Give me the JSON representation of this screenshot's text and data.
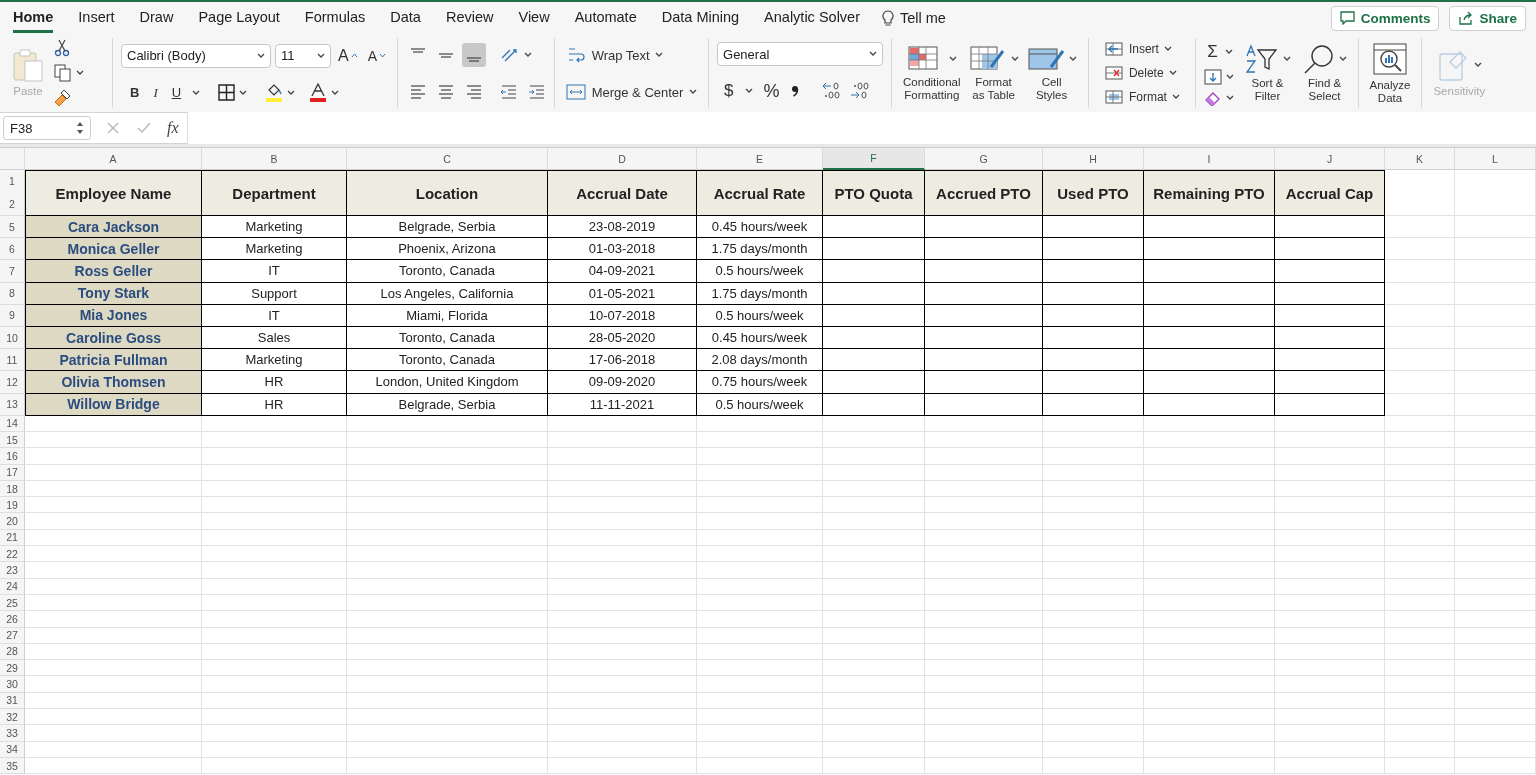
{
  "tabs": [
    {
      "label": "Home",
      "selected": true
    },
    {
      "label": "Insert",
      "selected": false
    },
    {
      "label": "Draw",
      "selected": false
    },
    {
      "label": "Page Layout",
      "selected": false
    },
    {
      "label": "Formulas",
      "selected": false
    },
    {
      "label": "Data",
      "selected": false
    },
    {
      "label": "Review",
      "selected": false
    },
    {
      "label": "View",
      "selected": false
    },
    {
      "label": "Automate",
      "selected": false
    },
    {
      "label": "Data Mining",
      "selected": false
    },
    {
      "label": "Analytic Solver",
      "selected": false
    }
  ],
  "tell_me": "Tell me",
  "top_buttons": {
    "comments": "Comments",
    "share": "Share"
  },
  "ribbon": {
    "paste": {
      "label": "Paste",
      "disabled": true
    },
    "font": {
      "name": "Calibri (Body)",
      "size": "11",
      "grow": "A",
      "shrink": "A",
      "bold": "B",
      "italic": "I",
      "underline": "U"
    },
    "vertical_align": [
      {
        "kind": "top",
        "selected": false
      },
      {
        "kind": "middle",
        "selected": false
      },
      {
        "kind": "bottom",
        "selected": true
      }
    ],
    "horizontal_align": [
      {
        "kind": "left",
        "selected": false
      },
      {
        "kind": "center",
        "selected": false
      },
      {
        "kind": "right",
        "selected": false
      }
    ],
    "wrap_text": "Wrap Text",
    "merge": "Merge & Center",
    "number": {
      "format": "General",
      "currency": "$",
      "percent": "%"
    },
    "styles": [
      {
        "kind": "conditional",
        "lines": [
          "Conditional",
          "Formatting"
        ]
      },
      {
        "kind": "table",
        "lines": [
          "Format",
          "as Table"
        ]
      },
      {
        "kind": "cell",
        "lines": [
          "Cell",
          "Styles"
        ]
      }
    ],
    "cells": [
      {
        "kind": "insert",
        "label": "Insert"
      },
      {
        "kind": "delete",
        "label": "Delete"
      },
      {
        "kind": "format",
        "label": "Format"
      }
    ],
    "editing": {
      "sum": "Σ",
      "sort": [
        "Sort &",
        "Filter"
      ],
      "find": [
        "Find &",
        "Select"
      ]
    },
    "analyze": [
      "Analyze",
      "Data"
    ],
    "sensitivity": {
      "label": "Sensitivity",
      "disabled": true
    }
  },
  "formula_bar": {
    "name_box": "F38",
    "fx": "fx"
  },
  "sheet": {
    "columns": [
      {
        "label": "A",
        "selected": false
      },
      {
        "label": "B",
        "selected": false
      },
      {
        "label": "C",
        "selected": false
      },
      {
        "label": "D",
        "selected": false
      },
      {
        "label": "E",
        "selected": false
      },
      {
        "label": "F",
        "selected": true
      },
      {
        "label": "G",
        "selected": false
      },
      {
        "label": "H",
        "selected": false
      },
      {
        "label": "I",
        "selected": false
      },
      {
        "label": "J",
        "selected": false
      },
      {
        "label": "K",
        "selected": false
      },
      {
        "label": "L",
        "selected": false
      }
    ],
    "header": {
      "row_numbers": [
        "1",
        "2"
      ],
      "cells": [
        "Employee Name",
        "Department",
        "Location",
        "Accrual Date",
        "Accrual Rate",
        "PTO Quota",
        "Accrued PTO",
        "Used PTO",
        "Remaining PTO",
        "Accrual Cap"
      ]
    },
    "rows": [
      {
        "number": "5",
        "cells": [
          "Cara Jackson",
          "Marketing",
          "Belgrade, Serbia",
          "23-08-2019",
          "0.45 hours/week"
        ]
      },
      {
        "number": "6",
        "cells": [
          "Monica Geller",
          "Marketing",
          "Phoenix, Arizona",
          "01-03-2018",
          "1.75 days/month"
        ]
      },
      {
        "number": "7",
        "cells": [
          "Ross Geller",
          "IT",
          "Toronto, Canada",
          "04-09-2021",
          "0.5 hours/week"
        ]
      },
      {
        "number": "8",
        "cells": [
          "Tony Stark",
          "Support",
          "Los Angeles, California",
          "01-05-2021",
          "1.75 days/month"
        ]
      },
      {
        "number": "9",
        "cells": [
          "Mia Jones",
          "IT",
          "Miami, Florida",
          "10-07-2018",
          "0.5 hours/week"
        ]
      },
      {
        "number": "10",
        "cells": [
          "Caroline Goss",
          "Sales",
          "Toronto, Canada",
          "28-05-2020",
          "0.45 hours/week"
        ]
      },
      {
        "number": "11",
        "cells": [
          "Patricia Fullman",
          "Marketing",
          "Toronto, Canada",
          "17-06-2018",
          "2.08 days/month"
        ]
      },
      {
        "number": "12",
        "cells": [
          "Olivia Thomsen",
          "HR",
          "London, United Kingdom",
          "09-09-2020",
          "0.75 hours/week"
        ]
      },
      {
        "number": "13",
        "cells": [
          "Willow Bridge",
          "HR",
          "Belgrade, Serbia",
          "11-11-2021",
          "0.5 hours/week"
        ]
      }
    ],
    "empty_rows": [
      "14",
      "15",
      "16",
      "17",
      "18",
      "19",
      "20",
      "21",
      "22",
      "23",
      "24",
      "25",
      "26",
      "27",
      "28",
      "29",
      "30",
      "31",
      "32",
      "33",
      "34",
      "35"
    ]
  }
}
